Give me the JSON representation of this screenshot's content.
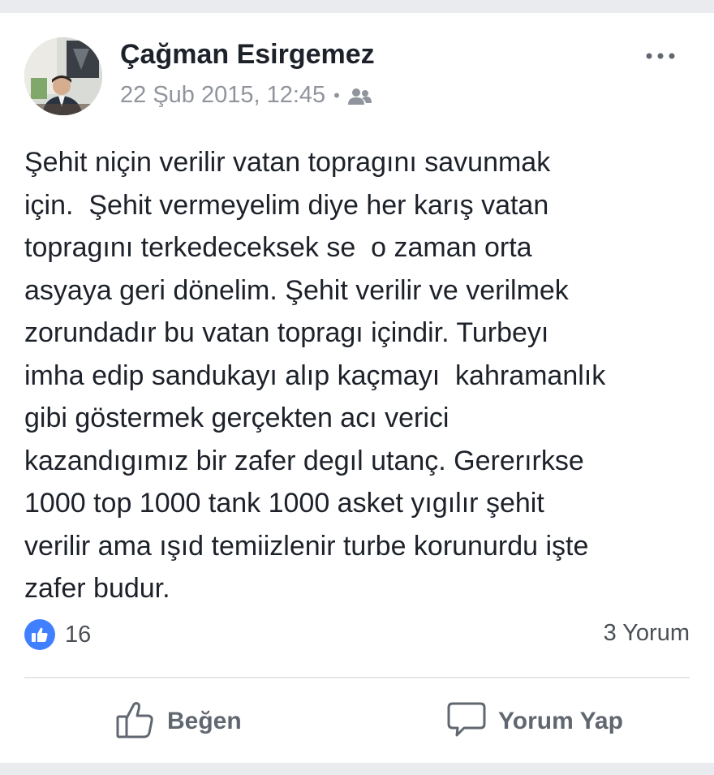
{
  "post": {
    "author": "Çağman Esirgemez",
    "timestamp": "22 Şub 2015, 12:45",
    "separator": "•",
    "privacy_icon": "friends-icon",
    "more_icon": "more-options-icon",
    "text": "Şehit niçin verilir vatan topragını savunmak\niçin.  Şehit vermeyelim diye her karış vatan\ntopragını terkedeceksek se  o zaman orta\nasyaya geri dönelim. Şehit verilir ve verilmek\nzorundadır bu vatan topragı içindir. Turbeyı\nimha edip sandukayı alıp kaçmayı  kahramanlık\ngibi göstermek gerçekten acı verici\nkazandıgımız bir zafer degıl utanç. Gererırkse\n1000 top 1000 tank 1000 asket yıgılır şehit\nverilir ama ışıd temiizlenir turbe korunurdu işte\nzafer budur."
  },
  "stats": {
    "reaction_count": "16",
    "comments_label": "3 Yorum"
  },
  "actions": {
    "like_label": "Beğen",
    "comment_label": "Yorum Yap"
  },
  "colors": {
    "like_blue": "#4080ff",
    "text_primary": "#1d2129",
    "text_secondary": "#90949c",
    "action_gray": "#616770"
  }
}
